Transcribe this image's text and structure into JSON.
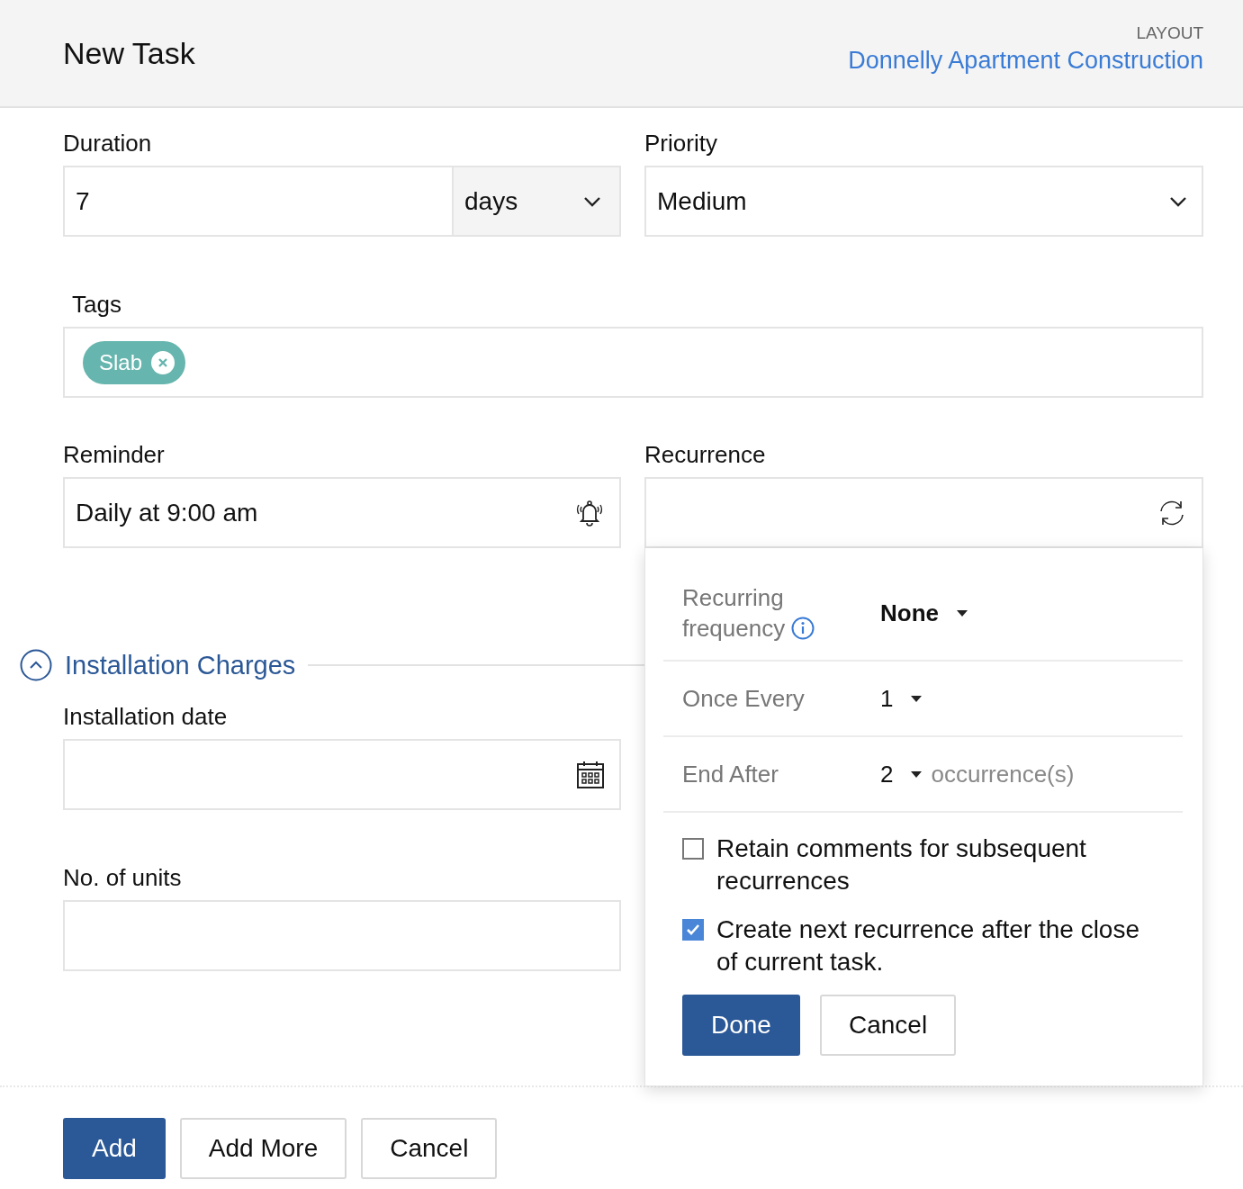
{
  "header": {
    "title": "New Task",
    "layout_label": "LAYOUT",
    "layout_name": "Donnelly Apartment Construction"
  },
  "duration": {
    "label": "Duration",
    "value": "7",
    "unit": "days"
  },
  "priority": {
    "label": "Priority",
    "value": "Medium"
  },
  "tags": {
    "label": "Tags",
    "items": [
      {
        "label": "Slab"
      }
    ]
  },
  "reminder": {
    "label": "Reminder",
    "value": "Daily at 9:00 am"
  },
  "recurrence": {
    "label": "Recurrence",
    "popup": {
      "rows": [
        {
          "label": "Recurring frequency",
          "info": true,
          "value": "None"
        },
        {
          "label": "Once Every",
          "info": false,
          "value": "1"
        },
        {
          "label": "End After",
          "info": false,
          "value": "2",
          "suffix": "occurrence(s)"
        }
      ],
      "options": [
        {
          "label": "Retain comments for subsequent recurrences",
          "checked": false
        },
        {
          "label": "Create next recurrence after the close of current task.",
          "checked": true
        }
      ],
      "buttons": [
        {
          "label": "Done",
          "kind": "primary"
        },
        {
          "label": "Cancel",
          "kind": "secondary"
        }
      ]
    }
  },
  "section": {
    "title": "Installation Charges",
    "expanded": true
  },
  "fields": [
    {
      "label": "Installation date",
      "kind": "date"
    },
    {
      "label": "No. of units",
      "kind": "text"
    }
  ],
  "footer_buttons": [
    {
      "label": "Add",
      "kind": "primary"
    },
    {
      "label": "Add More",
      "kind": "secondary"
    },
    {
      "label": "Cancel",
      "kind": "secondary"
    }
  ]
}
